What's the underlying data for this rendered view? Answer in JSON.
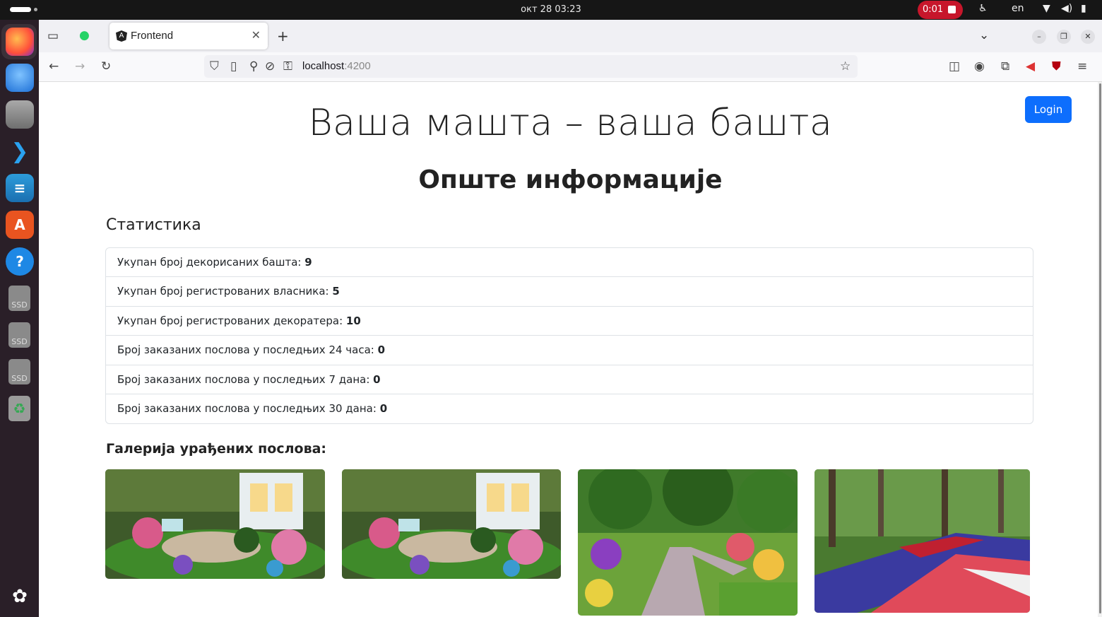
{
  "system": {
    "datetime": "окт 28  03:23",
    "recording": "0:01",
    "language": "en"
  },
  "browser": {
    "tab_title": "Frontend",
    "tab_favicon": "A",
    "url_host": "localhost",
    "url_port": ":4200"
  },
  "page": {
    "login_label": "Login",
    "site_title": "Ваша машта – ваша башта",
    "section_title": "Опште информације",
    "stats_heading": "Статистика",
    "stats": [
      {
        "label": "Укупан број декорисаних башта: ",
        "value": "9"
      },
      {
        "label": "Укупан број регистрованих власника: ",
        "value": "5"
      },
      {
        "label": "Укупан број регистрованих декоратера: ",
        "value": "10"
      },
      {
        "label": "Број заказаних послова у последњих 24 часа: ",
        "value": "0"
      },
      {
        "label": "Број заказаних послова у последњих 7 дана: ",
        "value": "0"
      },
      {
        "label": "Број заказаних послова у последњих 30 дана: ",
        "value": "0"
      }
    ],
    "gallery_heading": "Галерија урађених послова:"
  },
  "colors": {
    "primary": "#0d6efd",
    "record": "#c7162b",
    "dock_bg": "#2a1f28"
  },
  "icons": {
    "dock": [
      "firefox-icon",
      "thunderbird-icon",
      "files-icon",
      "vscode-icon",
      "writer-icon",
      "app-center-icon",
      "help-icon",
      "ssd-drive-icon",
      "ssd-drive-icon",
      "ssd-drive-icon",
      "trash-icon",
      "ubuntu-apps-icon"
    ]
  }
}
